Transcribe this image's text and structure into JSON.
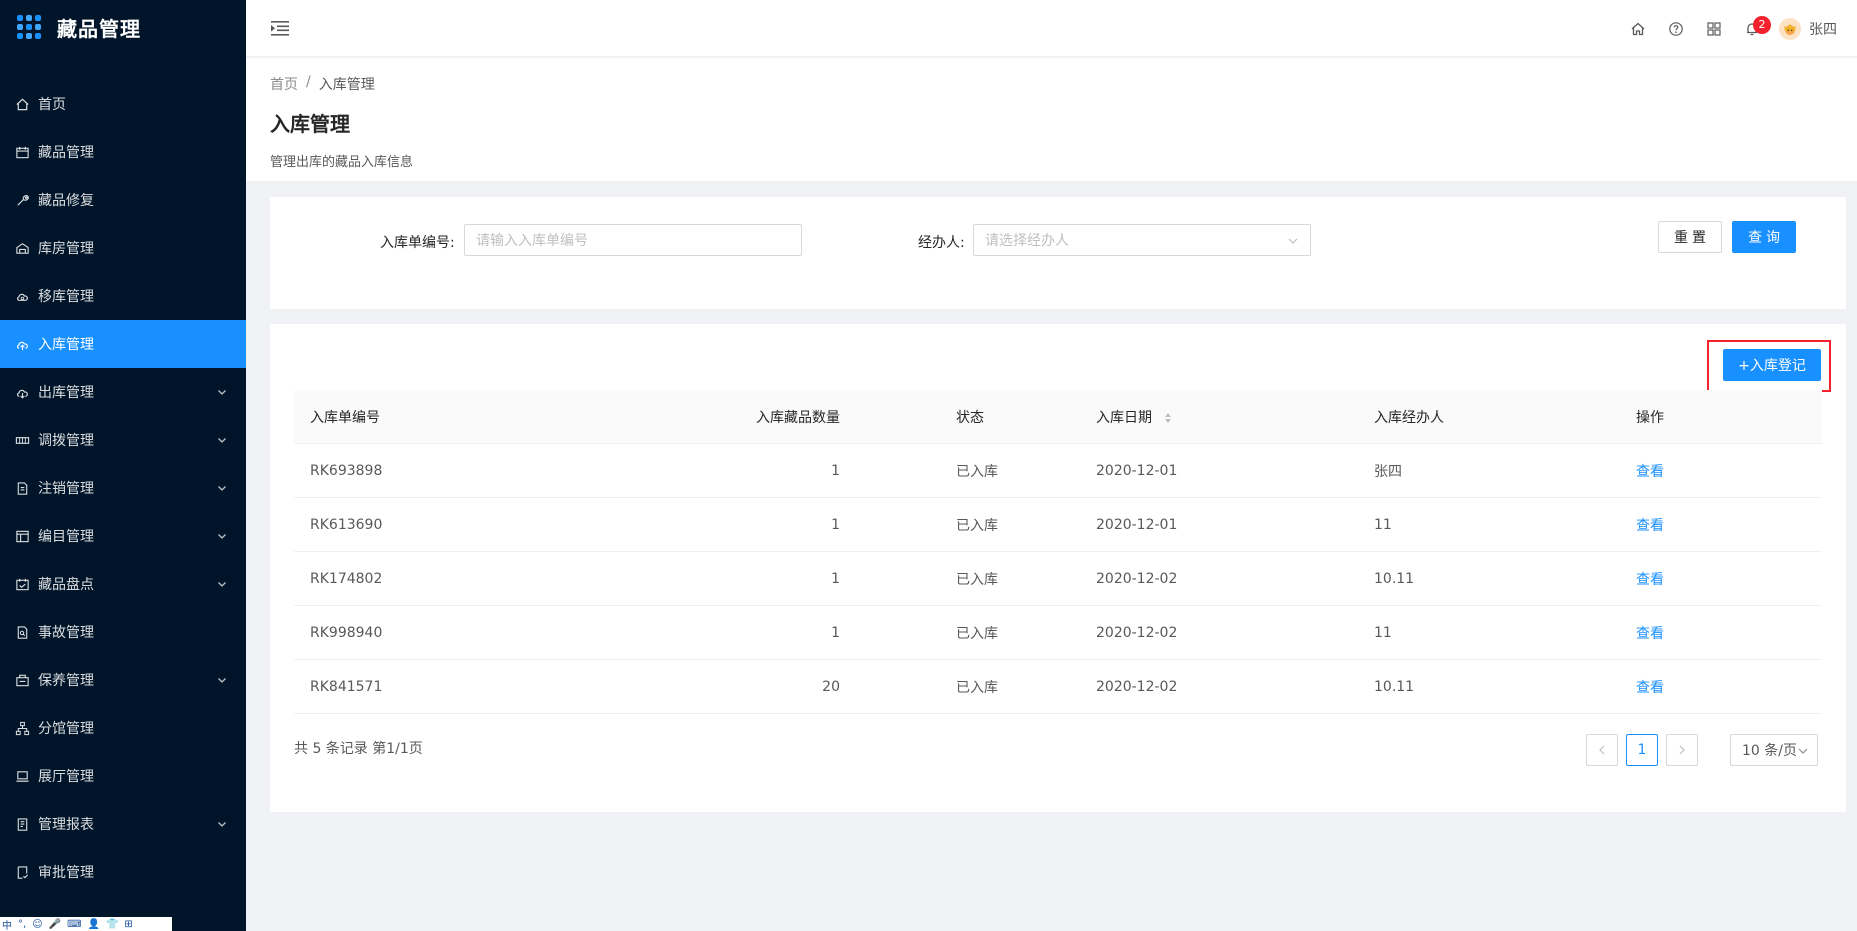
{
  "app": {
    "title": "藏品管理"
  },
  "sidebar": {
    "items": [
      {
        "label": "首页",
        "icon": "home-icon",
        "has_arrow": false,
        "active": false
      },
      {
        "label": "藏品管理",
        "icon": "calendar-icon",
        "has_arrow": false,
        "active": false
      },
      {
        "label": "藏品修复",
        "icon": "tool-icon",
        "has_arrow": false,
        "active": false
      },
      {
        "label": "库房管理",
        "icon": "warehouse-icon",
        "has_arrow": false,
        "active": false
      },
      {
        "label": "移库管理",
        "icon": "cloud-icon",
        "has_arrow": false,
        "active": false
      },
      {
        "label": "入库管理",
        "icon": "cloud-upload-icon",
        "has_arrow": false,
        "active": true
      },
      {
        "label": "出库管理",
        "icon": "cloud-download-icon",
        "has_arrow": true,
        "active": false
      },
      {
        "label": "调拨管理",
        "icon": "transfer-icon",
        "has_arrow": true,
        "active": false
      },
      {
        "label": "注销管理",
        "icon": "file-icon",
        "has_arrow": true,
        "active": false
      },
      {
        "label": "编目管理",
        "icon": "layout-icon",
        "has_arrow": true,
        "active": false
      },
      {
        "label": "藏品盘点",
        "icon": "schedule-icon",
        "has_arrow": true,
        "active": false
      },
      {
        "label": "事故管理",
        "icon": "file-search-icon",
        "has_arrow": false,
        "active": false
      },
      {
        "label": "保养管理",
        "icon": "build-icon",
        "has_arrow": true,
        "active": false
      },
      {
        "label": "分馆管理",
        "icon": "cluster-icon",
        "has_arrow": false,
        "active": false
      },
      {
        "label": "展厅管理",
        "icon": "laptop-icon",
        "has_arrow": false,
        "active": false
      },
      {
        "label": "管理报表",
        "icon": "report-icon",
        "has_arrow": true,
        "active": false
      },
      {
        "label": "审批管理",
        "icon": "audit-icon",
        "has_arrow": false,
        "active": false
      }
    ],
    "ime_bar": [
      "中",
      "°,",
      "☺",
      "🎤",
      "⌨",
      "👤",
      "👕",
      "⊞"
    ]
  },
  "header": {
    "notification_count": "2",
    "username": "张四",
    "icons": [
      "home-icon",
      "question-icon",
      "app-grid-icon",
      "bell-icon"
    ]
  },
  "page": {
    "breadcrumb": [
      "首页",
      "/",
      "入库管理"
    ],
    "title": "入库管理",
    "description": "管理出库的藏品入库信息"
  },
  "search": {
    "order_no_label": "入库单编号:",
    "order_no_placeholder": "请输入入库单编号",
    "handler_label": "经办人:",
    "handler_placeholder": "请选择经办人",
    "reset_label": "重置",
    "query_label": "查询"
  },
  "table": {
    "add_label": "+入库登记",
    "columns": [
      "入库单编号",
      "入库藏品数量",
      "状态",
      "入库日期",
      "入库经办人",
      "操作"
    ],
    "rows": [
      {
        "no": "RK693898",
        "qty": "1",
        "status": "已入库",
        "date": "2020-12-01",
        "handler": "张四",
        "action": "查看"
      },
      {
        "no": "RK613690",
        "qty": "1",
        "status": "已入库",
        "date": "2020-12-01",
        "handler": "11",
        "action": "查看"
      },
      {
        "no": "RK174802",
        "qty": "1",
        "status": "已入库",
        "date": "2020-12-02",
        "handler": "10.11",
        "action": "查看"
      },
      {
        "no": "RK998940",
        "qty": "1",
        "status": "已入库",
        "date": "2020-12-02",
        "handler": "11",
        "action": "查看"
      },
      {
        "no": "RK841571",
        "qty": "20",
        "status": "已入库",
        "date": "2020-12-02",
        "handler": "10.11",
        "action": "查看"
      }
    ]
  },
  "pagination": {
    "summary": "共 5 条记录 第1/1页",
    "current_page": "1",
    "page_size": "10 条/页"
  },
  "colors": {
    "primary": "#1890ff",
    "sidebar_bg": "#001529",
    "highlight": "#f5222d"
  }
}
